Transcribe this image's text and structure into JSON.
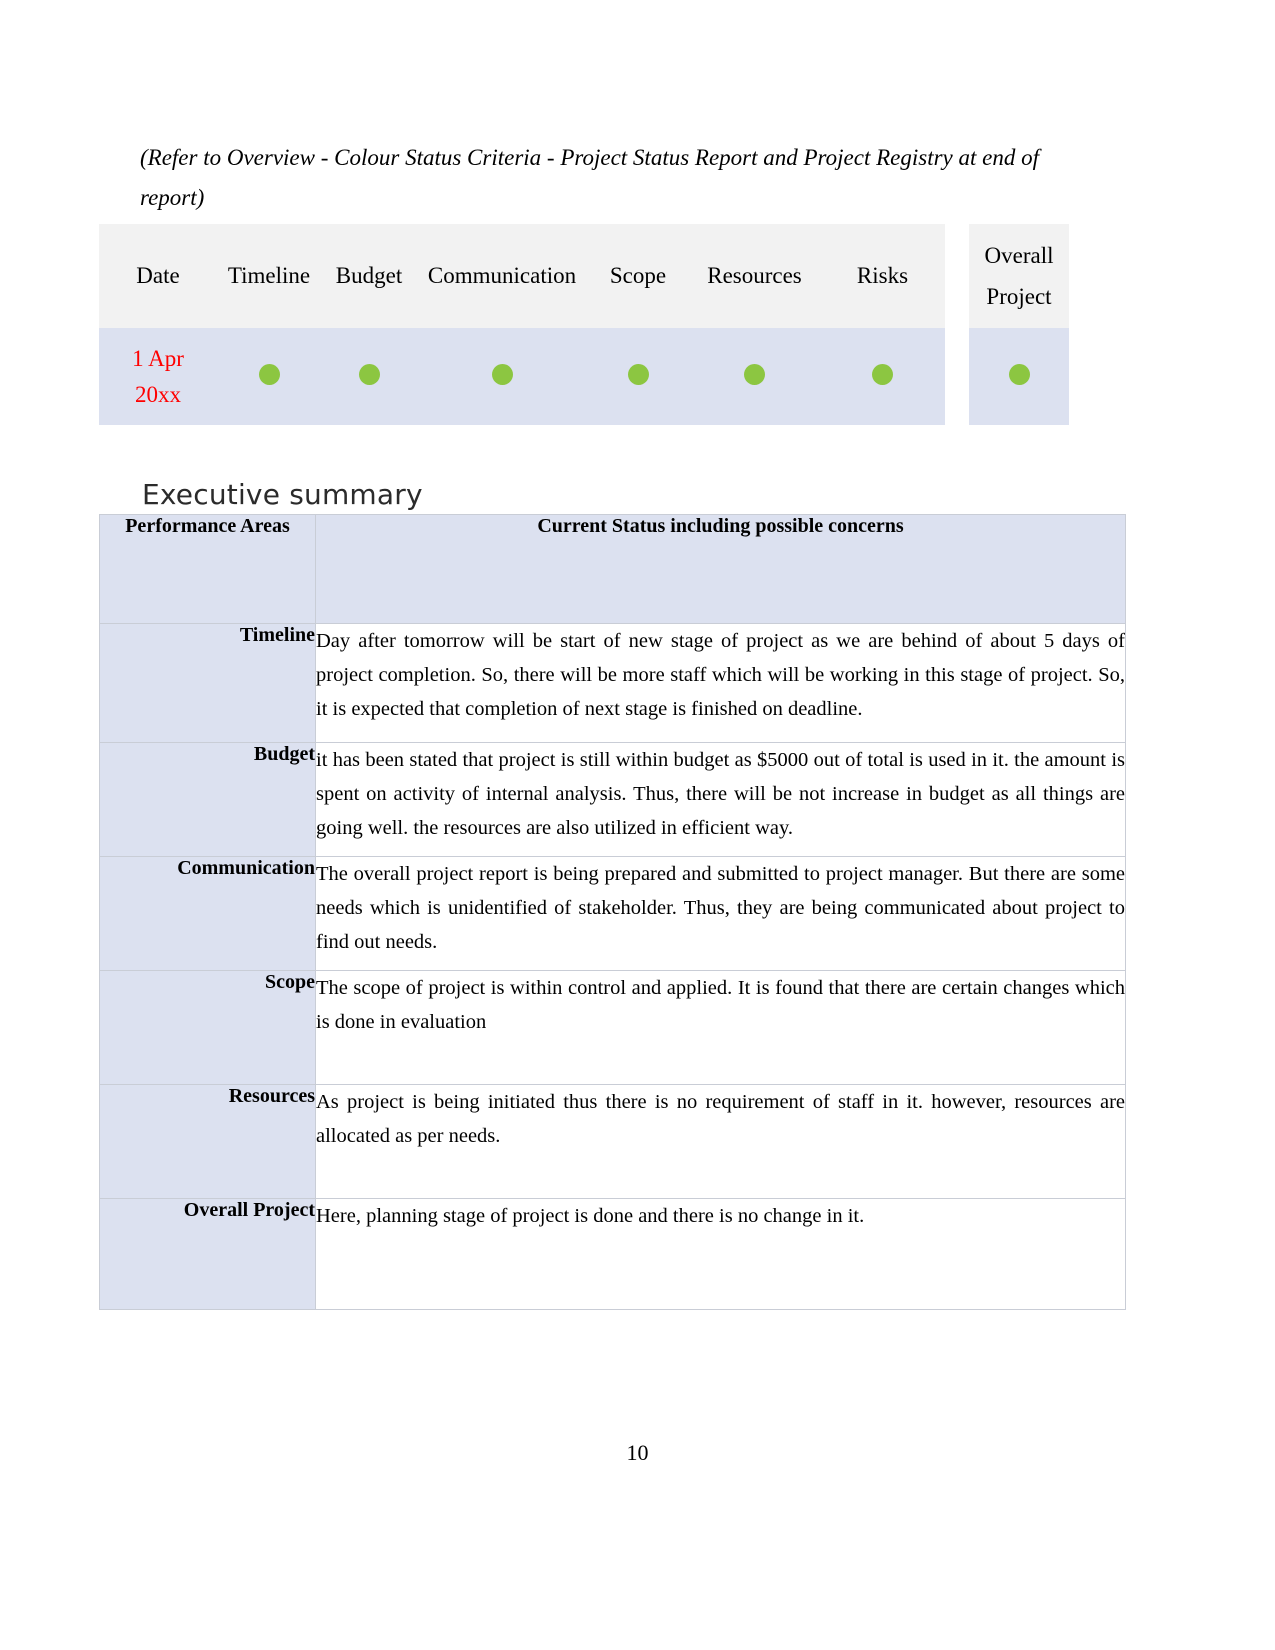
{
  "document": {
    "intro_note": "(Refer to Overview - Colour Status Criteria - Project Status Report and Project Registry at end of report)",
    "page_number": "10"
  },
  "status_table": {
    "headers": {
      "date": "Date",
      "timeline": "Timeline",
      "budget": "Budget",
      "communication": "Communication",
      "scope": "Scope",
      "resources": "Resources",
      "risks": "Risks",
      "overall_project": "Overall Project"
    },
    "row": {
      "date_line1": "1 Apr",
      "date_line2": "20xx",
      "timeline_status": "green",
      "budget_status": "green",
      "communication_status": "green",
      "scope_status": "green",
      "resources_status": "green",
      "risks_status": "green",
      "overall_status": "green"
    },
    "colors": {
      "green": "#8CC641",
      "header_bg": "#F2F2F2",
      "row_bg": "#DCE1F0",
      "date_text": "#FF0000"
    }
  },
  "executive_summary": {
    "heading": "Executive summary",
    "columns": {
      "areas": "Performance Areas",
      "status": "Current Status including possible concerns"
    },
    "rows": [
      {
        "area": "Timeline",
        "status": "Day after tomorrow will be start of new stage of project as we are behind of about 5 days of project completion. So, there will be more staff which will be working in this stage of project. So, it is expected that completion of next stage is finished on deadline."
      },
      {
        "area": "Budget",
        "status": "it has been stated that project is still within budget as $5000 out of total is used in it. the amount is spent on activity of internal analysis. Thus, there will be not increase in budget as all things are going well. the resources are also utilized in efficient way."
      },
      {
        "area": "Communication",
        "status": "The overall project report is being prepared and submitted to project manager. But there are some needs which is unidentified of stakeholder. Thus, they are being communicated about project to find out needs."
      },
      {
        "area": "Scope",
        "status": "The scope of project is within control and applied. It is found that there are certain changes which is done in evaluation"
      },
      {
        "area": "Resources",
        "status": "As project is being initiated thus there is no requirement of staff in it. however, resources are allocated as per needs."
      },
      {
        "area": "Overall Project",
        "status": "Here, planning stage of project is done and there is no change in it."
      }
    ]
  }
}
